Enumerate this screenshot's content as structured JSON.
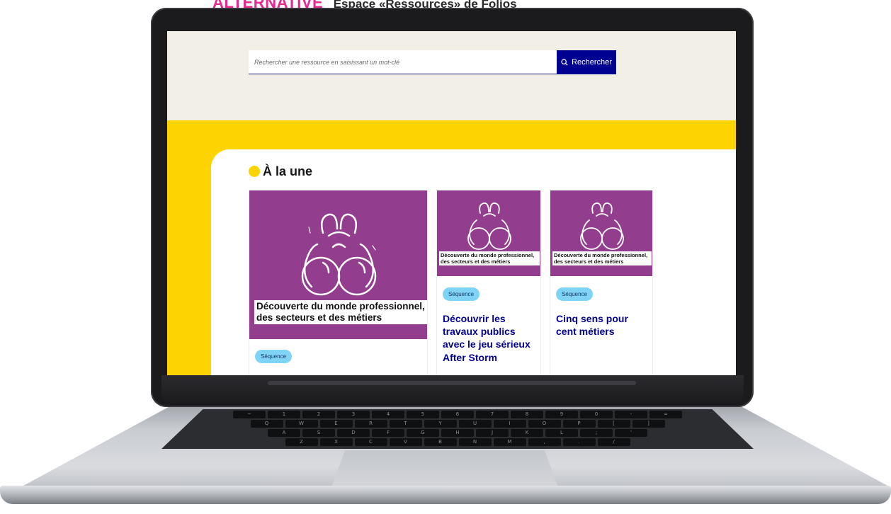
{
  "banner": {
    "tag": "ALTERNATIVE",
    "subtitle": "Espace «Ressources» de Folios"
  },
  "search": {
    "placeholder": "Rechercher une ressource en saisissant un mot-clé",
    "button_label": "Rechercher"
  },
  "section": {
    "title": "À la une"
  },
  "cards": [
    {
      "caption_line1": "Découverte du monde professionnel,",
      "caption_line2": "des secteurs et des métiers",
      "badge": "Séquence",
      "title": ""
    },
    {
      "caption_line1": "Découverte du monde professionnel,",
      "caption_line2": "des secteurs et des métiers",
      "badge": "Séquence",
      "title": "Découvrir les travaux publics avec le jeu sérieux After Storm"
    },
    {
      "caption_line1": "Découverte du monde professionnel,",
      "caption_line2": "des secteurs et des métiers",
      "badge": "Séquence",
      "title": "Cinq sens pour cent métiers"
    }
  ],
  "keyboard_rows": [
    [
      "~",
      "1",
      "2",
      "3",
      "4",
      "5",
      "6",
      "7",
      "8",
      "9",
      "0",
      "-",
      "="
    ],
    [
      "Q",
      "W",
      "E",
      "R",
      "T",
      "Y",
      "U",
      "I",
      "O",
      "P",
      "[",
      "]"
    ],
    [
      "A",
      "S",
      "D",
      "F",
      "G",
      "H",
      "J",
      "K",
      "L",
      ";",
      "'"
    ],
    [
      "Z",
      "X",
      "C",
      "V",
      "B",
      "N",
      "M",
      ",",
      ".",
      "/"
    ]
  ],
  "colors": {
    "banner_accent": "#e8288f",
    "button_bg": "#000091",
    "yellow": "#fed400",
    "card_purple": "#933d8f",
    "badge_bg": "#7fd4f5",
    "title_blue": "#000091"
  },
  "icons": {
    "search": "search-icon",
    "card_illustration": "binoculars-icon"
  }
}
